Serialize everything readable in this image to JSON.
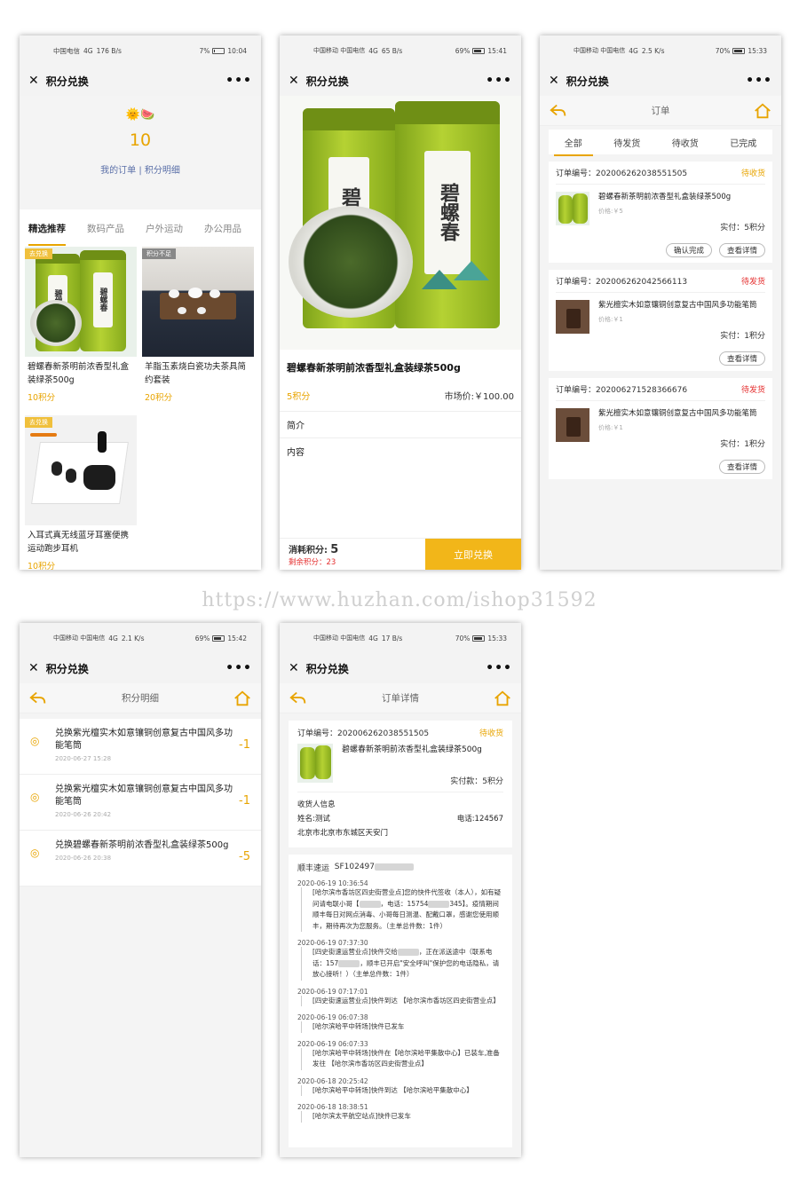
{
  "status_bars": {
    "p1": {
      "carrier": "中国电信",
      "signal": "4G",
      "speed": "176 B/s",
      "battery": "7%",
      "time": "10:04"
    },
    "p2": {
      "carrier": "中国移动 中国电信",
      "signal": "4G",
      "speed": "65 B/s",
      "battery": "69%",
      "time": "15:41"
    },
    "p3": {
      "carrier": "中国移动 中国电信",
      "signal": "4G",
      "speed": "2.5 K/s",
      "battery": "70%",
      "time": "15:33"
    },
    "p4": {
      "carrier": "中国移动 中国电信",
      "signal": "4G",
      "speed": "2.1 K/s",
      "battery": "69%",
      "time": "15:42"
    },
    "p5": {
      "carrier": "中国移动 中国电信",
      "signal": "4G",
      "speed": "17 B/s",
      "battery": "70%",
      "time": "15:33"
    }
  },
  "app_title": "积分兑换",
  "watermark": "https://www.huzhan.com/ishop31592",
  "home": {
    "points": "10",
    "my_orders": "我的订单",
    "separator": "|",
    "points_detail": "积分明细",
    "tabs": [
      "精选推荐",
      "数码产品",
      "户外运动",
      "办公用品"
    ],
    "products": [
      {
        "tag": "去兑换",
        "name": "碧螺春新茶明前浓香型礼盒装绿茶500g",
        "points": "10积分"
      },
      {
        "tag": "积分不足",
        "name": "羊脂玉素烧白瓷功夫茶具简约套装",
        "points": "20积分"
      },
      {
        "tag": "去兑换",
        "name": "入耳式真无线蓝牙耳塞便携运动跑步耳机",
        "points": "10积分"
      }
    ]
  },
  "detail": {
    "title": "碧螺春新茶明前浓香型礼盒装绿茶500g",
    "points": "5积分",
    "market_price": "市场价:￥100.00",
    "intro": "简介",
    "content": "内容",
    "consume_label": "消耗积分:",
    "consume_value": "5",
    "remain": "剩余积分：23",
    "exchange_btn": "立即兑换",
    "can_text": "碧螺春"
  },
  "orders": {
    "title": "订单",
    "tabs": [
      "全部",
      "待发货",
      "待收货",
      "已完成"
    ],
    "list": [
      {
        "no": "订单编号：202006262038551505",
        "status": "待收货",
        "name": "碧螺春新茶明前浓香型礼盒装绿茶500g",
        "price": "价格:￥5",
        "paid": "实付：5积分",
        "buttons": [
          "确认完成",
          "查看详情"
        ]
      },
      {
        "no": "订单编号：202006262042566113",
        "status": "待发货",
        "name": "紫光檀实木如意镶铜创意复古中国风多功能笔筒",
        "price": "价格:￥1",
        "paid": "实付：1积分",
        "buttons": [
          "查看详情"
        ]
      },
      {
        "no": "订单编号：202006271528366676",
        "status": "待发货",
        "name": "紫光檀实木如意镶铜创意复古中国风多功能笔筒",
        "price": "价格:￥1",
        "paid": "实付：1积分",
        "buttons": [
          "查看详情"
        ]
      }
    ]
  },
  "points_log": {
    "title": "积分明细",
    "items": [
      {
        "text": "兑换紫光檀实木如意镶铜创意复古中国风多功能笔筒",
        "time": "2020-06-27 15:28",
        "amount": "-1"
      },
      {
        "text": "兑换紫光檀实木如意镶铜创意复古中国风多功能笔筒",
        "time": "2020-06-26 20:42",
        "amount": "-1"
      },
      {
        "text": "兑换碧螺春新茶明前浓香型礼盒装绿茶500g",
        "time": "2020-06-26 20:38",
        "amount": "-5"
      }
    ]
  },
  "order_detail": {
    "title": "订单详情",
    "no": "订单编号：202006262038551505",
    "status": "待收货",
    "name": "碧螺春新茶明前浓香型礼盒装绿茶500g",
    "paid": "实付款：5积分",
    "receiver_title": "收货人信息",
    "receiver_name": "姓名:测试",
    "receiver_phone": "电话:124567",
    "address": "北京市北京市东城区天安门",
    "courier": "顺丰速运",
    "tracking_no": "SF102497",
    "events": [
      {
        "time": "2020-06-19 10:36:54",
        "desc_a": "[哈尔滨市香坊区四史街营业点]您的快件代签收（本人），如有疑问请电联小哥【",
        "desc_b": "，电话：15754",
        "desc_c": "345】。疫情期间顺丰每日对网点消毒、小哥每日测温、配戴口罩，感谢您使用顺丰，期待再次为您服务。（主单总件数：1件）"
      },
      {
        "time": "2020-06-19 07:37:30",
        "desc_a": "[四史街速运营业点]快件交给",
        "desc_b": "，正在派送途中（联系电话：157",
        "desc_c": "，顺丰已开启\"安全呼叫\"保护您的电话隐私，请放心接听！）（主单总件数：1件）"
      },
      {
        "time": "2020-06-19 07:17:01",
        "desc_a": "[四史街速运营业点]快件到达 【哈尔滨市香坊区四史街营业点】",
        "desc_b": "",
        "desc_c": ""
      },
      {
        "time": "2020-06-19 06:07:38",
        "desc_a": "[哈尔滨哈平中转场]快件已发车",
        "desc_b": "",
        "desc_c": ""
      },
      {
        "time": "2020-06-19 06:07:33",
        "desc_a": "[哈尔滨哈平中转场]快件在【哈尔滨哈平集散中心】已装车,准备发往 【哈尔滨市香坊区四史街营业点】",
        "desc_b": "",
        "desc_c": ""
      },
      {
        "time": "2020-06-18 20:25:42",
        "desc_a": "[哈尔滨哈平中转场]快件到达 【哈尔滨哈平集散中心】",
        "desc_b": "",
        "desc_c": ""
      },
      {
        "time": "2020-06-18 18:38:51",
        "desc_a": "[哈尔滨太平航空站点]快件已发车",
        "desc_b": "",
        "desc_c": ""
      }
    ]
  },
  "colors": {
    "accent": "#e8a400",
    "danger": "#e52f2f",
    "button": "#f2b619",
    "link": "#5a6fa8"
  }
}
